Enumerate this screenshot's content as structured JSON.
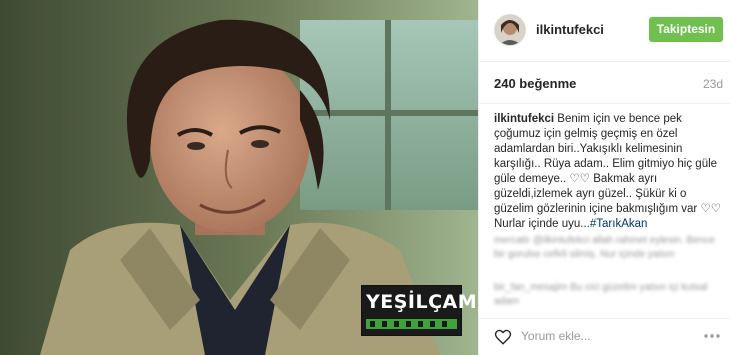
{
  "profile": {
    "username": "ilkintufekci",
    "follow_label": "Takiptesin"
  },
  "photo": {
    "logo_text": "YEŞİLÇAM"
  },
  "stats": {
    "likes": "240 beğenme",
    "age": "23d"
  },
  "caption": {
    "username": "ilkintufekci",
    "text": "Benim için ve bence pek çoğumuz için gelmiş geçmiş en özel adamlardan biri..Yakışıklı kelimesinin karşılığı.. Rüya adam.. Elim gitmiyo hiç güle güle demeye.. ♡♡ Bakmak ayrı güzeldi,izlemek ayrı güzel.. Şükür ki o güzelim gözlerinin içine bakmışlığım var ♡♡ Nurlar içinde uyu...",
    "hashtag": "#TarıkAkan"
  },
  "comments": [
    {
      "text": "mercatir @ilkintufekci allah rahmet eylesin. Bence bir gorulse cefirli silmiş. Nur içinde yatsın"
    },
    {
      "text": "bir_fan_mesajim Bu cici güzelim yatsın içi kutsal adam"
    }
  ],
  "footer": {
    "comment_placeholder": "Yorum ekle..."
  },
  "icons": {
    "heart": "heart-icon",
    "more": "more-icon"
  },
  "colors": {
    "follow_button": "#70c050",
    "hashtag": "#003569",
    "logo_green": "#3fa33a"
  }
}
